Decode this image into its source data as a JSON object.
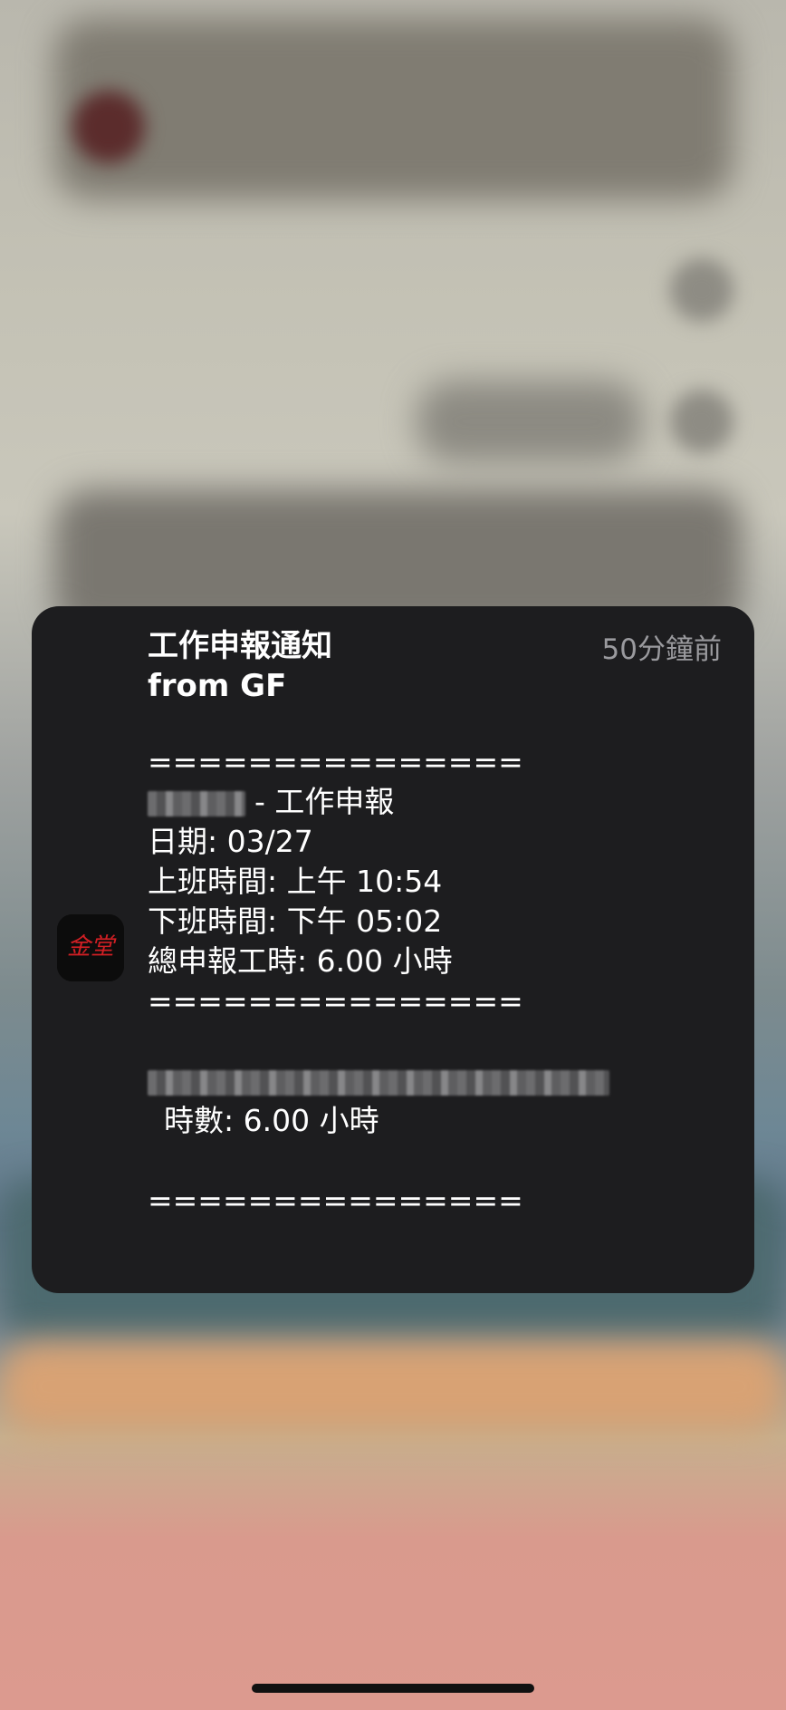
{
  "notification": {
    "app_icon": "jintang-app-icon",
    "app_icon_text": "金堂",
    "title_line1": "工作申報通知",
    "title_line2": "from GF",
    "timestamp": "50分鐘前",
    "body": {
      "separator": "===============",
      "report_suffix": "- 工作申報",
      "date": "日期: 03/27",
      "clock_in": "上班時間: 上午 10:54",
      "clock_out": "下班時間: 下午 05:02",
      "total_hours": "總申報工時: 6.00 小時",
      "task_hours": "時數: 6.00 小時"
    }
  },
  "colors": {
    "card_bg": "#1d1d1f",
    "text": "#ffffff",
    "timestamp": "#9a9a9e",
    "icon_accent": "#d11f24"
  }
}
